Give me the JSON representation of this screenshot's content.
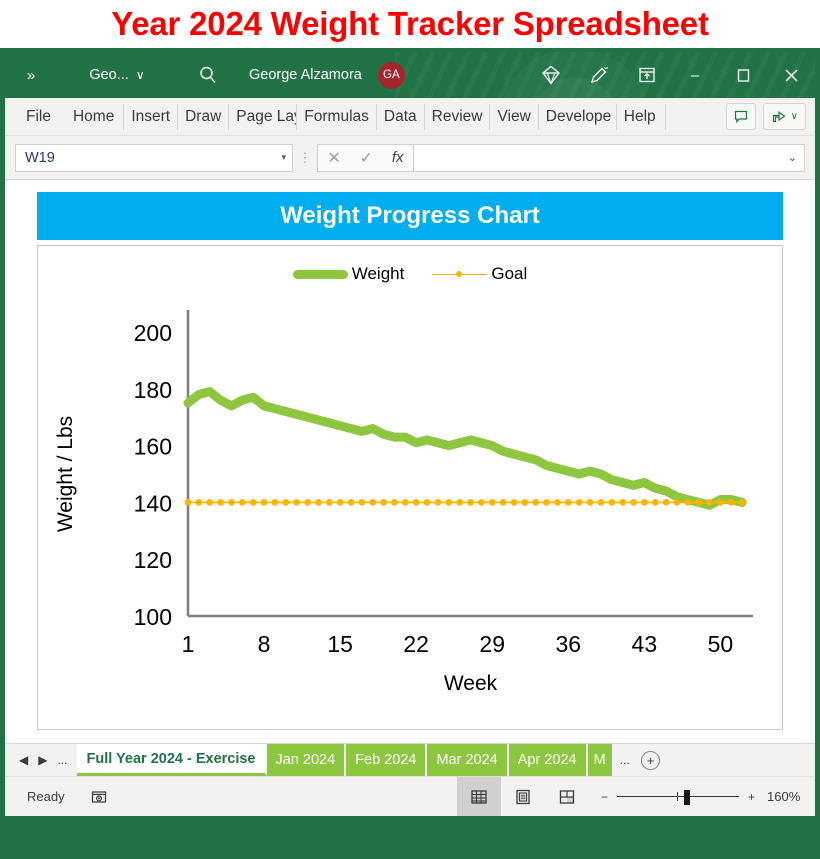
{
  "page": {
    "heading": "Year 2024 Weight Tracker Spreadsheet"
  },
  "titlebar": {
    "overflow_chevron": "»",
    "file_name": "Geo...",
    "file_dropdown_caret": "∨",
    "search_icon": "search-icon",
    "user_name": "George Alzamora",
    "avatar_initials": "GA",
    "avatar_color": "#A4262C",
    "copilot_icon": "diamond-icon",
    "pen_icon": "pen-icon",
    "ribbon_display_icon": "ribbon-display-options-icon",
    "minimize": "–",
    "maximize": "▢",
    "close": "✕",
    "background_color": "#217346"
  },
  "ribbon": {
    "tabs": [
      "File",
      "Home",
      "Insert",
      "Draw",
      "Page Layo",
      "Formulas",
      "Data",
      "Review",
      "View",
      "Develope",
      "Help"
    ],
    "comment_button": "comment-icon",
    "share_button": "share-icon",
    "share_caret": "∨"
  },
  "formula_bar": {
    "name_box_value": "W19",
    "name_box_caret": "▾",
    "cancel_icon": "✕",
    "confirm_icon": "✓",
    "function_icon": "fx",
    "formula_value": "",
    "formula_placeholder": "",
    "expand_caret": "⌄"
  },
  "chart_panel": {
    "banner_title": "Weight Progress Chart",
    "banner_color": "#00AEEF"
  },
  "chart_data": {
    "type": "line",
    "title": "Weight Progress Chart",
    "xlabel": "Week",
    "ylabel": "Weight / Lbs",
    "xlim": [
      1,
      53
    ],
    "ylim": [
      100,
      200
    ],
    "yticks": [
      100,
      120,
      140,
      160,
      180,
      200
    ],
    "xticks": [
      1,
      8,
      15,
      22,
      29,
      36,
      43,
      50
    ],
    "grid": false,
    "legend_position": "top-center",
    "x": [
      1,
      2,
      3,
      4,
      5,
      6,
      7,
      8,
      9,
      10,
      11,
      12,
      13,
      14,
      15,
      16,
      17,
      18,
      19,
      20,
      21,
      22,
      23,
      24,
      25,
      26,
      27,
      28,
      29,
      30,
      31,
      32,
      33,
      34,
      35,
      36,
      37,
      38,
      39,
      40,
      41,
      42,
      43,
      44,
      45,
      46,
      47,
      48,
      49,
      50,
      51,
      52
    ],
    "series": [
      {
        "name": "Weight",
        "color": "#8DC63F",
        "line_width": 9,
        "values": [
          175,
          178,
          179,
          176,
          174,
          176,
          177,
          174,
          173,
          172,
          171,
          170,
          169,
          168,
          167,
          166,
          165,
          166,
          164,
          163,
          163,
          161,
          162,
          161,
          160,
          161,
          162,
          161,
          160,
          158,
          157,
          156,
          155,
          153,
          152,
          151,
          150,
          151,
          150,
          148,
          147,
          146,
          147,
          145,
          144,
          142,
          141,
          140,
          139,
          141,
          141,
          140
        ]
      },
      {
        "name": "Goal",
        "color": "#FFB500",
        "line_width": 1.6,
        "marker": "circle",
        "values": [
          140,
          140,
          140,
          140,
          140,
          140,
          140,
          140,
          140,
          140,
          140,
          140,
          140,
          140,
          140,
          140,
          140,
          140,
          140,
          140,
          140,
          140,
          140,
          140,
          140,
          140,
          140,
          140,
          140,
          140,
          140,
          140,
          140,
          140,
          140,
          140,
          140,
          140,
          140,
          140,
          140,
          140,
          140,
          140,
          140,
          140,
          140,
          140,
          140,
          140,
          140,
          140
        ]
      }
    ]
  },
  "sheet_tabs": {
    "nav_prev": "◀",
    "nav_next": "▶",
    "nav_ellipsis": "...",
    "tabs": [
      {
        "label": "Full Year 2024 - Exercise",
        "active": true
      },
      {
        "label": "Jan 2024",
        "active": false
      },
      {
        "label": "Feb 2024",
        "active": false
      },
      {
        "label": "Mar 2024",
        "active": false
      },
      {
        "label": "Apr 2024",
        "active": false
      },
      {
        "label": "M",
        "active": false
      }
    ],
    "overflow_ellipsis": "...",
    "add_sheet": "+"
  },
  "status_bar": {
    "status": "Ready",
    "recording_icon": "macro-record-icon",
    "view_normal": "normal-view-icon",
    "view_page_layout": "page-layout-view-icon",
    "view_page_break": "page-break-view-icon",
    "zoom_out": "−",
    "zoom_in": "+",
    "zoom_level": "160%"
  }
}
